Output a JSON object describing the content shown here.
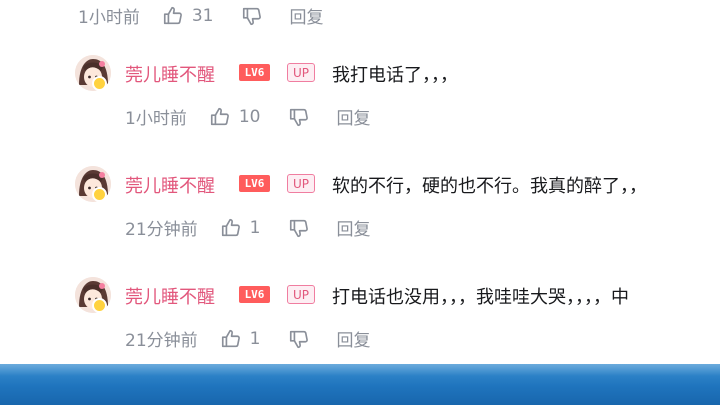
{
  "top_meta": {
    "time": "1小时前",
    "likes": "31",
    "reply": "回复"
  },
  "comments": [
    {
      "username": "莞儿睡不醒",
      "level": "LV6",
      "up_badge": "UP",
      "text": "我打电话了，，，",
      "time": "1小时前",
      "likes": "10",
      "reply": "回复"
    },
    {
      "username": "莞儿睡不醒",
      "level": "LV6",
      "up_badge": "UP",
      "text": "软的不行，硬的也不行。我真的醉了，，",
      "time": "21分钟前",
      "likes": "1",
      "reply": "回复"
    },
    {
      "username": "莞儿睡不醒",
      "level": "LV6",
      "up_badge": "UP",
      "text": "打电话也没用，，，我哇哇大哭，，，，中",
      "time": "21分钟前",
      "likes": "1",
      "reply": "回复"
    }
  ],
  "colors": {
    "username": "#e2577c",
    "level_badge": "#ff5c5c",
    "meta": "#8a8f99",
    "band": "#1f74bd"
  },
  "icons": [
    "thumbs-up-icon",
    "thumbs-down-icon"
  ]
}
